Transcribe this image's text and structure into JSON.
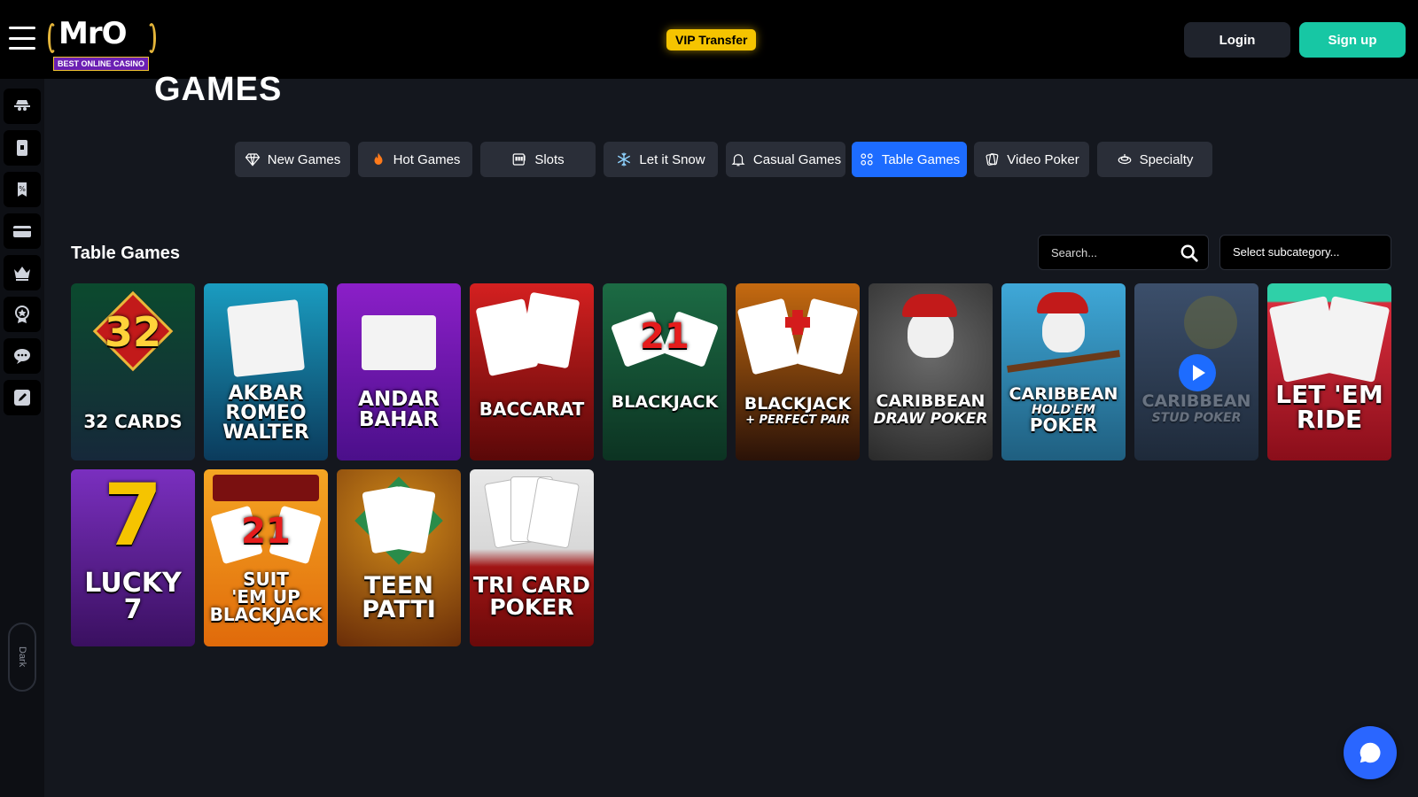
{
  "header": {
    "logo_text": "MrO",
    "logo_tagline": "BEST ONLINE CASINO",
    "vip_label": "VIP Transfer",
    "login_label": "Login",
    "signup_label": "Sign up"
  },
  "sidebar": {
    "items": [
      {
        "icon": "detective-icon"
      },
      {
        "icon": "card-icon"
      },
      {
        "icon": "promo-tag-icon"
      },
      {
        "icon": "credit-card-icon"
      },
      {
        "icon": "crown-icon"
      },
      {
        "icon": "vip-badge-icon"
      },
      {
        "icon": "chat-support-icon"
      },
      {
        "icon": "edit-icon"
      }
    ],
    "dark_toggle_label": "Dark"
  },
  "page": {
    "title": "GAMES"
  },
  "categories": [
    {
      "label": "New Games",
      "icon": "diamond-icon",
      "active": false
    },
    {
      "label": "Hot Games",
      "icon": "flame-icon",
      "active": false
    },
    {
      "label": "Slots",
      "icon": "slot-machine-icon",
      "active": false
    },
    {
      "label": "Let it Snow",
      "icon": "snowflake-icon",
      "active": false
    },
    {
      "label": "Casual Games",
      "icon": "bell-icon",
      "active": false
    },
    {
      "label": "Table Games",
      "icon": "table-icon",
      "active": true
    },
    {
      "label": "Video Poker",
      "icon": "cards-icon",
      "active": false
    },
    {
      "label": "Specialty",
      "icon": "wheel-icon",
      "active": false
    }
  ],
  "section": {
    "title": "Table Games",
    "search_placeholder": "Search...",
    "subcategory_label": "Select subcategory..."
  },
  "games": [
    {
      "name": "32 CARDS",
      "big": "32",
      "colors": [
        "#0b4a2e",
        "#16283a"
      ]
    },
    {
      "name": "AKBAR\nROMEO\nWALTER",
      "colors": [
        "#1a9cc0",
        "#0b3b5c"
      ]
    },
    {
      "name": "ANDAR\nBAHAR",
      "colors": [
        "#8b1fc8",
        "#4b0f8a"
      ]
    },
    {
      "name": "BACCARAT",
      "colors": [
        "#d42020",
        "#5a0808"
      ]
    },
    {
      "name": "BLACKJACK",
      "big": "21",
      "colors": [
        "#1c6b44",
        "#0c3322"
      ]
    },
    {
      "name": "BLACKJACK",
      "sub": "+ PERFECT PAIR",
      "colors": [
        "#c56a10",
        "#2a1208"
      ]
    },
    {
      "name": "CARIBBEAN",
      "sub": "DRAW POKER",
      "colors": [
        "#4a4a4a",
        "#2a2a2a"
      ]
    },
    {
      "name": "CARIBBEAN",
      "sub": "HOLD'EM",
      "name2": "POKER",
      "colors": [
        "#3fa8d8",
        "#1f5f80"
      ]
    },
    {
      "name": "CARIBBEAN",
      "sub": "STUD POKER",
      "colors": [
        "#3c4f6b",
        "#1e2a3a"
      ],
      "hover": true
    },
    {
      "name": "LET 'EM\nRIDE",
      "colors": [
        "#2fd0a8",
        "#d82c3c"
      ]
    },
    {
      "name": "LUCKY\n7",
      "big": "7",
      "colors": [
        "#7a2fbf",
        "#3a1060"
      ]
    },
    {
      "name": "SUIT\n'EM UP\nBLACKJACK",
      "big": "21",
      "colors": [
        "#f5a623",
        "#e06a0a"
      ]
    },
    {
      "name": "TEEN\nPATTI",
      "colors": [
        "#d08a1a",
        "#6a2d08"
      ]
    },
    {
      "name": "TRI CARD\nPOKER",
      "colors": [
        "#e8e8e8",
        "#8a0e0e"
      ]
    }
  ],
  "colors": {
    "accent_blue": "#1d6cff",
    "accent_teal": "#17c7a4",
    "vip_yellow": "#f5c400"
  }
}
